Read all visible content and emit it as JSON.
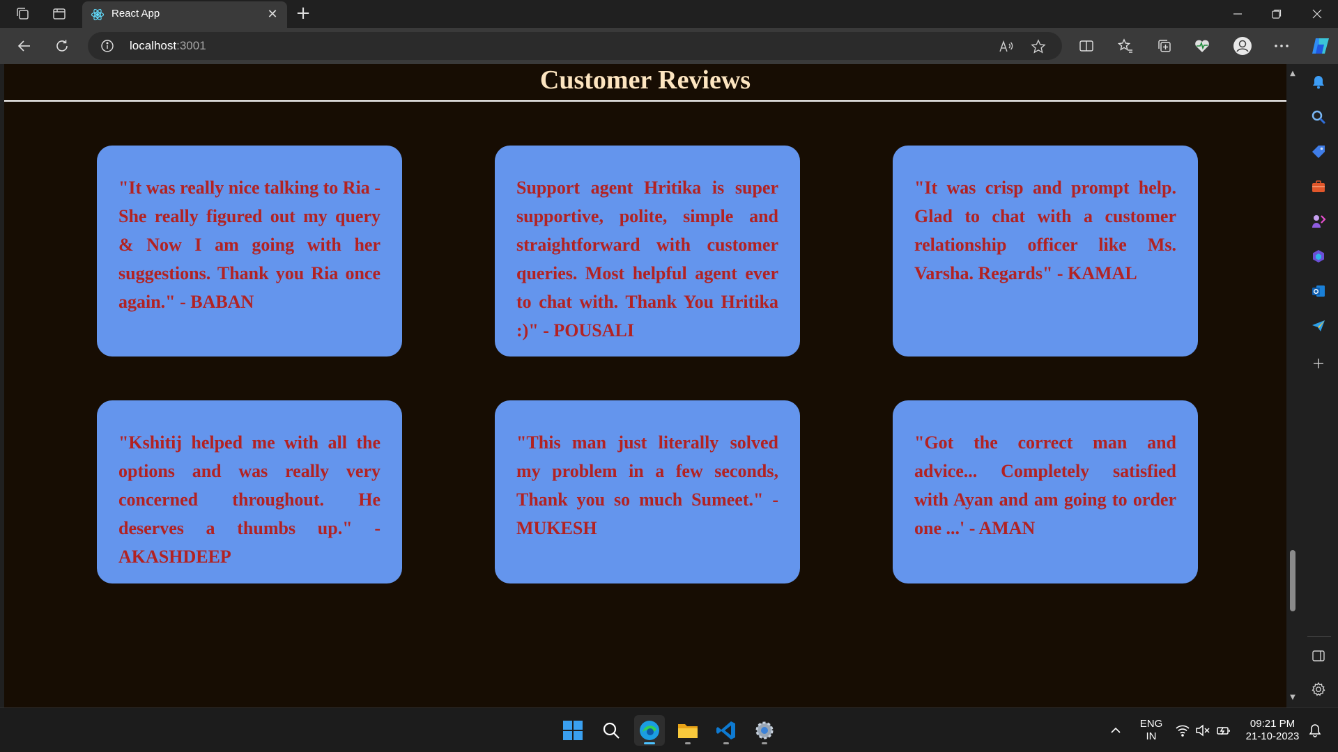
{
  "browser": {
    "tab_title": "React App",
    "address_host": "localhost",
    "address_port": ":3001"
  },
  "page": {
    "title": "Customer Reviews",
    "reviews": [
      "\"It was really nice talking to Ria - She really figured out my query & Now I am going with her suggestions. Thank you Ria once again.\" - BABAN",
      "Support agent Hritika is super supportive, polite, simple and straightforward with customer queries. Most helpful agent ever to chat with. Thank You Hritika :)\" - POUSALI",
      "\"It was crisp and prompt help. Glad to chat with a customer relationship officer like Ms. Varsha. Regards\" - KAMAL",
      "\"Kshitij helped me with all the options and was really very concerned throughout. He deserves a thumbs up.\" - AKASHDEEP",
      "\"This man just literally solved my problem in a few seconds, Thank you so much Sumeet.\" - MUKESH",
      "\"Got the correct man and advice... Completely satisfied with Ayan and am going to order one ...' - AMAN"
    ],
    "colors": {
      "background": "#170d03",
      "title": "#fde5c0",
      "card": "#6495ed",
      "card_text": "#b22222"
    }
  },
  "taskbar": {
    "lang_line1": "ENG",
    "lang_line2": "IN",
    "time": "09:21 PM",
    "date": "21-10-2023"
  }
}
